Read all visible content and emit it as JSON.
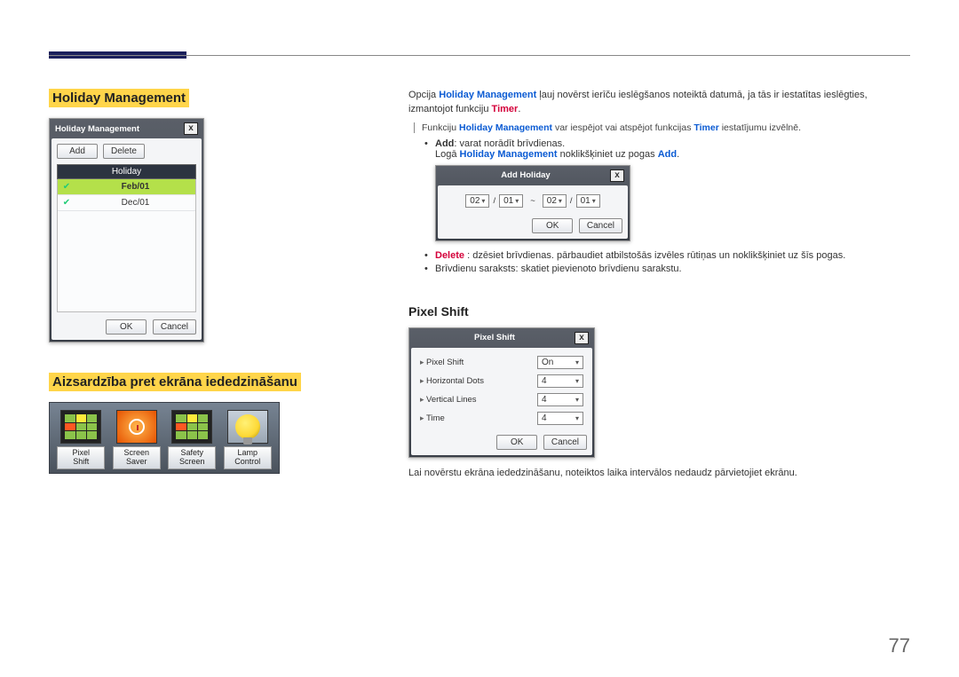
{
  "page_number": "77",
  "heading_hm": "Holiday Management",
  "heading_burn": "Aizsardzība pret ekrāna iededzināšanu",
  "heading_ps": "Pixel Shift",
  "hm_dialog": {
    "title": "Holiday Management",
    "add": "Add",
    "delete": "Delete",
    "col": "Holiday",
    "rows": [
      "Feb/01",
      "Dec/01"
    ],
    "ok": "OK",
    "cancel": "Cancel"
  },
  "ah_dialog": {
    "title": "Add Holiday",
    "m1": "02",
    "d1": "01",
    "m2": "02",
    "d2": "01",
    "sep": "~",
    "ok": "OK",
    "cancel": "Cancel"
  },
  "icons": {
    "pixel_shift": "Pixel\nShift",
    "screen_saver": "Screen\nSaver",
    "safety_screen": "Safety\nScreen",
    "lamp_control": "Lamp\nControl"
  },
  "ps_dialog": {
    "title": "Pixel Shift",
    "rows": [
      {
        "label": "Pixel Shift",
        "value": "On"
      },
      {
        "label": "Horizontal Dots",
        "value": "4"
      },
      {
        "label": "Vertical Lines",
        "value": "4"
      },
      {
        "label": "Time",
        "value": "4"
      }
    ],
    "ok": "OK",
    "cancel": "Cancel"
  },
  "txt": {
    "p1a": "Opcija ",
    "p1b": "Holiday Management",
    "p1c": " ļauj novērst ierīču ieslēgšanos noteiktā datumā, ja tās ir iestatītas ieslēgties, izmantojot funkciju ",
    "p1d": "Timer",
    "p1e": ".",
    "note_a": "Funkciju ",
    "note_b": "Holiday Management",
    "note_c": " var iespējot vai atspējot funkcijas ",
    "note_d": "Timer",
    "note_e": " iestatījumu izvēlnē.",
    "add_b": "Add",
    "add_t": ": varat norādīt brīvdienas.",
    "add_line2a": "Logā ",
    "add_line2b": "Holiday Management",
    "add_line2c": " noklikšķiniet uz pogas ",
    "add_line2d": "Add",
    "add_line2e": ".",
    "del_b": "Delete",
    "del_t": " : dzēsiet brīvdienas. pārbaudiet atbilstošās izvēles rūtiņas un noklikšķiniet uz šīs pogas.",
    "list_t": "Brīvdienu saraksts: skatiet pievienoto brīvdienu sarakstu.",
    "ps_desc": "Lai novērstu ekrāna iededzināšanu, noteiktos laika intervālos nedaudz pārvietojiet ekrānu."
  }
}
